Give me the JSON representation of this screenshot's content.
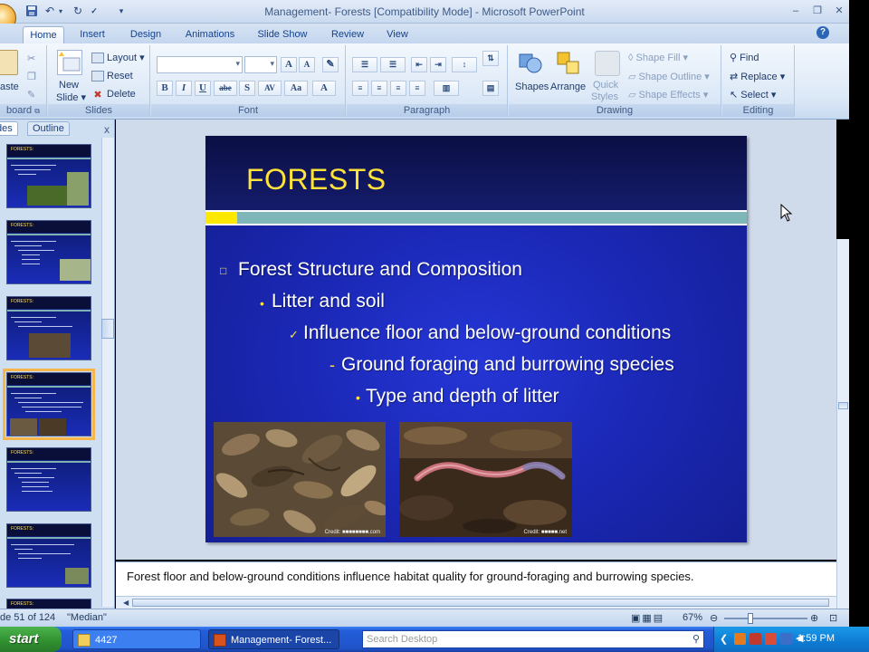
{
  "app": {
    "title": "Management- Forests [Compatibility Mode] - Microsoft PowerPoint"
  },
  "quick_access": [
    "save-icon",
    "undo-icon",
    "redo-icon",
    "spelling-icon",
    "customize-icon"
  ],
  "tabs": [
    {
      "label": "Home",
      "active": true
    },
    {
      "label": "Insert"
    },
    {
      "label": "Design"
    },
    {
      "label": "Animations"
    },
    {
      "label": "Slide Show"
    },
    {
      "label": "Review"
    },
    {
      "label": "View"
    }
  ],
  "ribbon": {
    "clipboard": {
      "paste": "aste",
      "label": "board"
    },
    "slides": {
      "new_slide": "New",
      "new_slide_2": "Slide",
      "layout": "Layout",
      "reset": "Reset",
      "delete": "Delete",
      "label": "Slides"
    },
    "font": {
      "label": "Font",
      "buttons": [
        "B",
        "I",
        "U",
        "abe",
        "S",
        "AV",
        "Aa",
        "A"
      ]
    },
    "paragraph": {
      "label": "Paragraph"
    },
    "drawing": {
      "shapes": "Shapes",
      "arrange": "Arrange",
      "quick": "Quick",
      "styles": "Styles",
      "shape_fill": "Shape Fill",
      "shape_outline": "Shape Outline",
      "shape_effects": "Shape Effects",
      "label": "Drawing"
    },
    "editing": {
      "find": "Find",
      "replace": "Replace",
      "select": "Select",
      "label": "Editing"
    }
  },
  "left_pane": {
    "tabs": [
      {
        "label": "des",
        "active": true
      },
      {
        "label": "Outline"
      }
    ],
    "close": "x",
    "thumbnails": [
      {
        "title": "FORESTS:",
        "selected": false
      },
      {
        "title": "FORESTS:",
        "selected": false
      },
      {
        "title": "FORESTS:",
        "selected": false
      },
      {
        "title": "FORESTS:",
        "selected": true
      },
      {
        "title": "FORESTS:",
        "selected": false
      },
      {
        "title": "FORESTS:",
        "selected": false
      },
      {
        "title": "FORESTS:",
        "selected": false
      }
    ]
  },
  "slide": {
    "title": "FORESTS",
    "bullets": [
      {
        "level": 1,
        "marker": "□",
        "text": "Forest Structure and Composition"
      },
      {
        "level": 2,
        "marker": "•",
        "text": "Litter and soil"
      },
      {
        "level": 3,
        "marker": "✓",
        "text": "Influence floor and below-ground conditions"
      },
      {
        "level": 4,
        "marker": "-",
        "text": "Ground foraging and burrowing species"
      },
      {
        "level": 5,
        "marker": "•",
        "text": "Type and depth of litter"
      }
    ],
    "photos": [
      {
        "name": "leaf-litter-photo",
        "credit": "Credit: ■■■■■■■■.com"
      },
      {
        "name": "earthworm-photo",
        "credit": "Credit: ■■■■■.net"
      }
    ]
  },
  "notes": {
    "text": "Forest floor and below-ground conditions influence habitat quality for ground-foraging and burrowing species."
  },
  "status": {
    "slide_counter": "de 51 of 124",
    "theme": "\"Median\"",
    "zoom": "67%"
  },
  "taskbar": {
    "start": "start",
    "tasks": [
      {
        "label": "4427"
      },
      {
        "label": "Management- Forest..."
      }
    ],
    "search_placeholder": "Search Desktop",
    "clock": "1:59 PM"
  }
}
